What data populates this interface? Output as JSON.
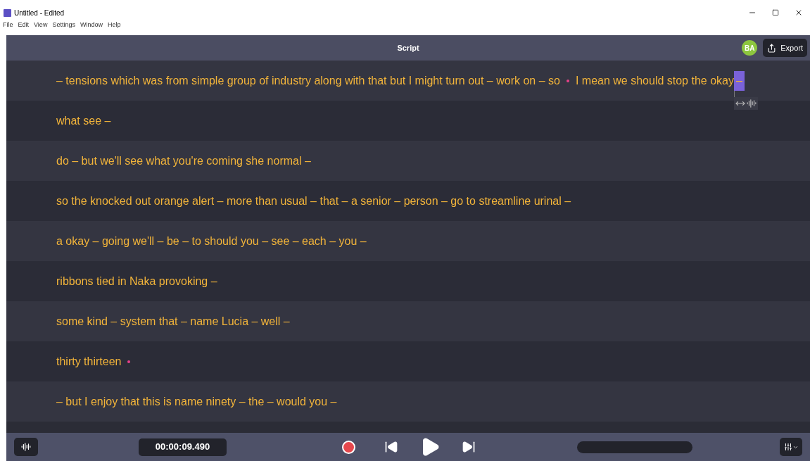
{
  "window": {
    "title": "Untitled - Edited"
  },
  "menu": [
    "File",
    "Edit",
    "View",
    "Settings",
    "Window",
    "Help"
  ],
  "header": {
    "title": "Script",
    "avatar": "BA",
    "export": "Export"
  },
  "lines": [
    {
      "tokens": [
        {
          "kind": "text",
          "text": "– tensions which was from simple group of industry along with that but I might turn out – work on – so"
        },
        {
          "kind": "dot"
        },
        {
          "kind": "text",
          "text": "I mean we should stop the okay"
        },
        {
          "kind": "cursor",
          "text": "–"
        }
      ]
    },
    {
      "tokens": [
        {
          "kind": "text",
          "text": "what see –"
        }
      ]
    },
    {
      "tokens": [
        {
          "kind": "text",
          "text": "do – but we'll see what you're coming she normal –"
        }
      ]
    },
    {
      "tokens": [
        {
          "kind": "text",
          "text": "so the knocked out orange alert – more than usual – that – a senior – person – go to streamline urinal –"
        }
      ]
    },
    {
      "tokens": [
        {
          "kind": "text",
          "text": "a okay – going we'll – be – to should you – see – each – you –"
        }
      ]
    },
    {
      "tokens": [
        {
          "kind": "text",
          "text": "ribbons tied in Naka provoking –"
        }
      ]
    },
    {
      "tokens": [
        {
          "kind": "text",
          "text": "some kind – system that – name Lucia – well –"
        }
      ]
    },
    {
      "tokens": [
        {
          "kind": "text",
          "text": "thirty thirteen"
        },
        {
          "kind": "dot"
        }
      ]
    },
    {
      "tokens": [
        {
          "kind": "text",
          "text": "– but I enjoy that this is name ninety – the – would you –"
        }
      ]
    }
  ],
  "footer": {
    "time": "00:00:09.490"
  }
}
